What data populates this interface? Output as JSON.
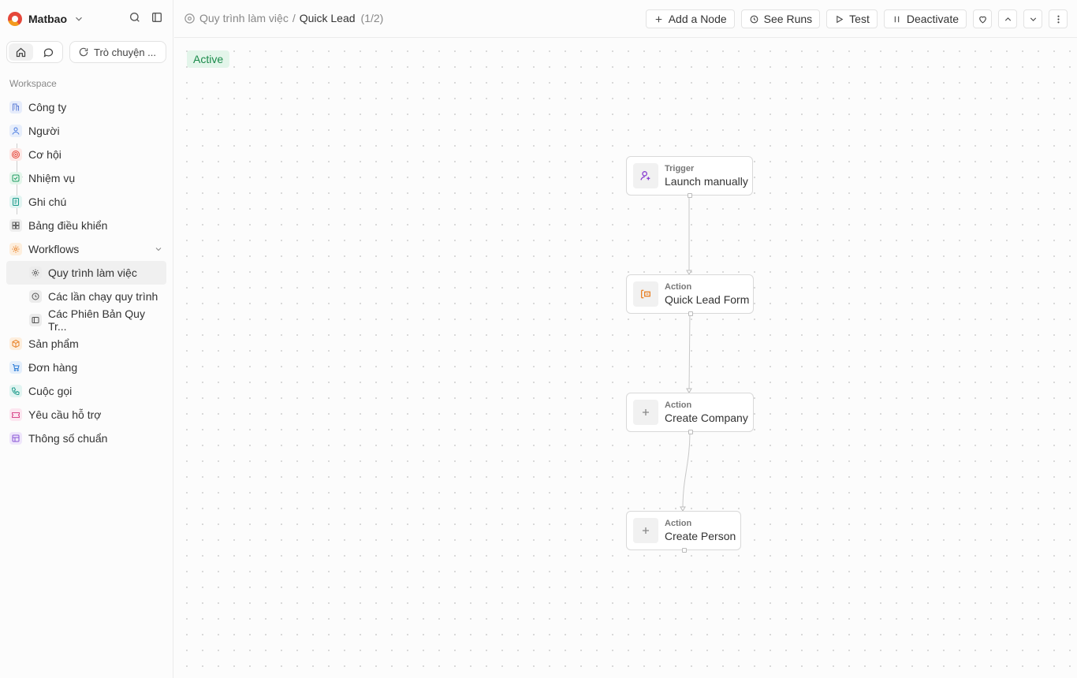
{
  "workspace": {
    "name": "Matbao"
  },
  "sidebar": {
    "chat_label": "Trò chuyện ...",
    "section_label": "Workspace",
    "items": [
      {
        "label": "Công ty",
        "icon": "building-icon",
        "color": "#5b7bd5",
        "bg": "#e6ecfb"
      },
      {
        "label": "Người",
        "icon": "user-icon",
        "color": "#4a7be0",
        "bg": "#e7eefb"
      },
      {
        "label": "Cơ hội",
        "icon": "target-icon",
        "color": "#e5483b",
        "bg": "#fde8e6"
      },
      {
        "label": "Nhiệm vụ",
        "icon": "checkbox-icon",
        "color": "#1f9d63",
        "bg": "#e3f5ea"
      },
      {
        "label": "Ghi chú",
        "icon": "note-icon",
        "color": "#1a9a8a",
        "bg": "#e1f4f1"
      },
      {
        "label": "Bảng điều khiển",
        "icon": "dashboard-icon",
        "color": "#666666",
        "bg": "#eeeeee"
      },
      {
        "label": "Workflows",
        "icon": "workflow-icon",
        "color": "#e8832a",
        "bg": "#fdeedd"
      },
      {
        "label": "Quy trình làm việc",
        "icon": "workflow-gear-icon"
      },
      {
        "label": "Các lần chạy quy trình",
        "icon": "history-icon"
      },
      {
        "label": "Các Phiên Bản Quy Tr...",
        "icon": "versions-icon"
      },
      {
        "label": "Sản phẩm",
        "icon": "box-icon",
        "color": "#e8832a",
        "bg": "#fdeedd"
      },
      {
        "label": "Đơn hàng",
        "icon": "cart-icon",
        "color": "#2b7bd6",
        "bg": "#e3eefb"
      },
      {
        "label": "Cuộc gọi",
        "icon": "phone-icon",
        "color": "#1a9a8a",
        "bg": "#e1f4f1"
      },
      {
        "label": "Yêu cầu hỗ trợ",
        "icon": "ticket-icon",
        "color": "#d94a8c",
        "bg": "#fce6f0"
      },
      {
        "label": "Thông số chuẩn",
        "icon": "spec-icon",
        "color": "#8a55d6",
        "bg": "#efe6fb"
      }
    ]
  },
  "breadcrumb": {
    "parent": "Quy trình làm việc",
    "sep": "/",
    "current": "Quick Lead",
    "count": "(1/2)"
  },
  "toolbar": {
    "add_node": "Add a Node",
    "see_runs": "See Runs",
    "test": "Test",
    "deactivate": "Deactivate"
  },
  "canvas": {
    "status": "Active",
    "nodes": [
      {
        "type": "Trigger",
        "label": "Launch manually",
        "icon": "user-plus-icon",
        "icon_color": "#8a3fd1"
      },
      {
        "type": "Action",
        "label": "Quick Lead Form",
        "icon": "form-icon",
        "icon_color": "#e8832a"
      },
      {
        "type": "Action",
        "label": "Create Company",
        "icon": "plus-icon",
        "icon_color": "#888888"
      },
      {
        "type": "Action",
        "label": "Create Person",
        "icon": "plus-icon",
        "icon_color": "#888888"
      }
    ]
  }
}
